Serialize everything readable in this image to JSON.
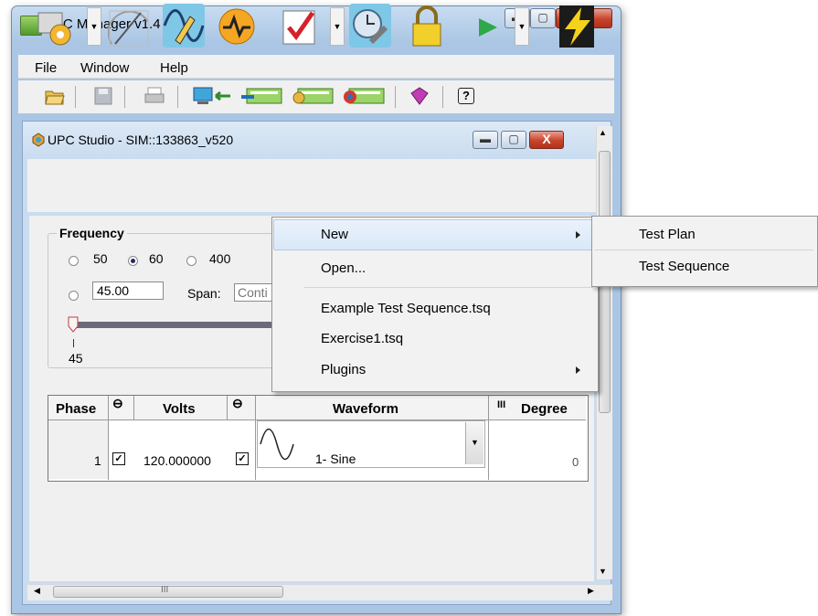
{
  "outer_window": {
    "title": "UPC Manager v1.4",
    "caption_buttons": {
      "minimize": "▬",
      "maximize": "▢",
      "close": "X"
    }
  },
  "menubar": {
    "file": "File",
    "window": "Window",
    "help": "Help"
  },
  "toolbar": {
    "icons": [
      "open-folder-icon",
      "save-icon",
      "print-icon",
      "connect-device-icon",
      "upload-icon",
      "config-icon",
      "sync-icon",
      "book-icon",
      "help-icon"
    ],
    "help_glyph": "?"
  },
  "inner_window": {
    "title": "UPC Studio - SIM::133863_v520",
    "caption_buttons": {
      "minimize": "▬",
      "maximize": "▢",
      "close": "X"
    },
    "toolbar_icons": [
      "settings-gear-icon",
      "meter-icon",
      "waveform-edit-icon",
      "pulse-icon",
      "checklist-icon",
      "tools-clock-icon",
      "lock-icon",
      "play-icon",
      "lightning-icon"
    ]
  },
  "frequency": {
    "label": "Frequency",
    "options": [
      "50",
      "60",
      "400"
    ],
    "selected": "60",
    "custom_value": "45.00",
    "span_label": "Span:",
    "span_value": "Conti",
    "slider_value_label": "45",
    "slider_position": 0
  },
  "table": {
    "headers": {
      "phase": "Phase",
      "volts": "Volts",
      "waveform": "Waveform",
      "degree": "Degree"
    },
    "link_glyph": "⊖",
    "degree_glyph": "III",
    "rows": [
      {
        "phase": "1",
        "volts_checked": true,
        "volts": "120.000000",
        "waveform_checked": true,
        "waveform": "1- Sine",
        "degree": "0"
      }
    ],
    "check_glyph": "✓"
  },
  "context_menu": {
    "items": [
      {
        "label": "New",
        "submenu": true,
        "highlighted": true
      },
      {
        "label": "Open...",
        "submenu": false
      },
      {
        "label": "Example Test Sequence.tsq",
        "submenu": false
      },
      {
        "label": "Exercise1.tsq",
        "submenu": false
      },
      {
        "label": "Plugins",
        "submenu": true
      }
    ]
  },
  "submenu": {
    "items": [
      {
        "label": "Test Plan"
      },
      {
        "label": "Test Sequence"
      }
    ]
  },
  "scroll": {
    "h_thumb_grip": "III"
  }
}
